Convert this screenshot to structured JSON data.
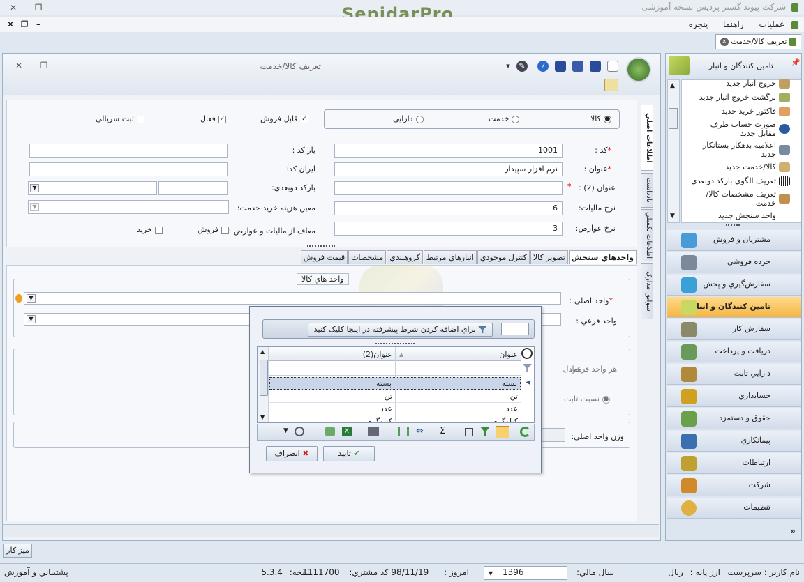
{
  "app": {
    "title": "شرکت پیوند گستر پردیس نسخه آموزشی",
    "logo": "SepidarPro"
  },
  "menu": [
    "عملیات",
    "راهنما",
    "پنجره"
  ],
  "doc_tab": {
    "label": "تعریف کالا/خدمت"
  },
  "form_window": {
    "title": "تعریف کالا/خدمت",
    "type_options": [
      {
        "label": "کالا",
        "selected": true
      },
      {
        "label": "خدمت",
        "selected": false
      },
      {
        "label": "دارايي",
        "selected": false
      }
    ],
    "checks": [
      {
        "label": "قابل فروش",
        "checked": true
      },
      {
        "label": "فعال",
        "checked": true
      },
      {
        "label": "ثبت سريالي",
        "checked": false
      }
    ],
    "fields": {
      "code": {
        "label": "کد :",
        "value": "1001"
      },
      "title": {
        "label": "عنوان :",
        "value": "نرم افزار سپيدار"
      },
      "title2": {
        "label": "عنوان (2) :",
        "value": ""
      },
      "tax_rate": {
        "label": "نرخ ماليات:",
        "value": "6"
      },
      "duty_rate": {
        "label": "نرخ عوارض:",
        "value": "3"
      },
      "barcode": {
        "label": "بار کد :",
        "value": ""
      },
      "iran_code": {
        "label": "ايران کد:",
        "value": ""
      },
      "barcode2d": {
        "label": "بارکد دوبعدي:",
        "value": ""
      },
      "service_cost": {
        "label": "معين هزينه خريد خدمت:",
        "value": ""
      },
      "exempt": {
        "label": "معاف از ماليات و عوارض :"
      },
      "exempt_sale": {
        "label": "فروش"
      },
      "exempt_buy": {
        "label": "خريد"
      }
    },
    "side_tabs": [
      "اطلاعات اصلي",
      "يادداشت",
      "اطلاعات تکميلي",
      "سوابق مدارک"
    ],
    "tabs": [
      "واحدهاي سنجش",
      "تصوير کالا",
      "کنترل موجودي",
      "انبارهاي مرتبط",
      "گروهبندي",
      "مشخصات",
      "قيمت فروش"
    ],
    "units_group": {
      "title": "واحد هاي کالا",
      "main_unit_label": "واحد اصلي :",
      "sub_unit_label": "واحد فرعي :",
      "per_sub_label": "هر واحد فرعي",
      "equals_label": "معادل",
      "fixed_ratio_label": "نسبت ثابت",
      "main_weight_label": "وزن واحد اصلي:"
    }
  },
  "lookup": {
    "filter_hint": "براي اضافه کردن شرط پيشرفته در اينجا کليک کنيد",
    "columns": [
      "عنوان",
      "عنوان(2)"
    ],
    "rows": [
      {
        "title": "بسته",
        "title2": "بسته"
      },
      {
        "title": "تن",
        "title2": "تن"
      },
      {
        "title": "عدد",
        "title2": "عدد"
      },
      {
        "title": "کيلوگرم",
        "title2": "کيلوگرم"
      }
    ],
    "ok_label": "تاييد",
    "cancel_label": "انصراف"
  },
  "nav_panel": {
    "header": "تامين کنندگان و انبار",
    "tree": [
      "خروج انبار جديد",
      "برگشت خروج انبار جديد",
      "فاکتور خريد جديد",
      "صورت حساب طرف مقابل جديد",
      "اعلاميه بدهکار بستانکار جديد",
      "کالا/خدمت جديد",
      "تعريف الگوي بارکد دوبعدي",
      "تعريف مشخصات کالا/خدمت",
      "واحد سنجش جديد"
    ],
    "modules": [
      {
        "label": "مشتريان و فروش",
        "color": "#4a9ad8"
      },
      {
        "label": "خرده فروشي",
        "color": "#7a8a9a"
      },
      {
        "label": "سفارش‌گيري و پخش",
        "color": "#3aa0d8"
      },
      {
        "label": "تامين کنندگان و انبار",
        "color": "#e0a020",
        "active": true
      },
      {
        "label": "سفارش کار",
        "color": "#8a8a6a"
      },
      {
        "label": "دريافت و پرداخت",
        "color": "#6a9a5a"
      },
      {
        "label": "دارايي ثابت",
        "color": "#b08a3a"
      },
      {
        "label": "حسابداري",
        "color": "#d0a020"
      },
      {
        "label": "حقوق و دستمزد",
        "color": "#6aa04a"
      },
      {
        "label": "پيمانکاري",
        "color": "#3a70b0"
      },
      {
        "label": "ارتباطات",
        "color": "#c0a030"
      },
      {
        "label": "شرکت",
        "color": "#d08a2a"
      },
      {
        "label": "تنظيمات",
        "color": "#e0b040"
      }
    ]
  },
  "desk_tab": "ميز کار",
  "status": {
    "user_label": "نام کاربر :",
    "user": "سرپرست",
    "currency_label": "ارز پايه :",
    "currency": "ريال",
    "fiscal_label": "سال مالي:",
    "fiscal": "1396",
    "today_label": "امروز :",
    "today": "98/11/19",
    "customer_label": "کد مشتري:",
    "customer": "1111700",
    "version_label": "نسخه:",
    "version": "5.3.4",
    "support": "پشتيباني و آموزش"
  }
}
